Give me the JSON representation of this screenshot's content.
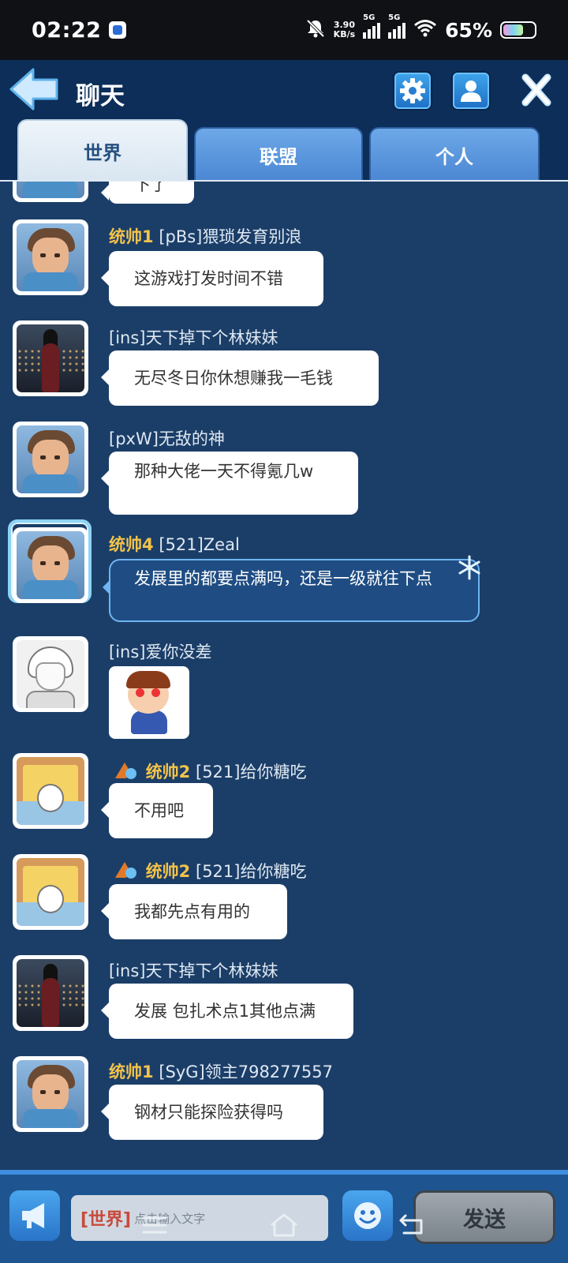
{
  "status_bar": {
    "time": "02:22",
    "net_speed_value": "3.90",
    "net_speed_unit": "KB/s",
    "signal1_label": "5G",
    "signal2_label": "5G",
    "battery": "65%"
  },
  "header": {
    "title": "聊天",
    "tabs": [
      "世界",
      "联盟",
      "个人"
    ],
    "active_tab": "世界"
  },
  "messages": [
    {
      "rank": "",
      "name": "",
      "text": "下了",
      "avatar": "hero"
    },
    {
      "rank": "统帅1",
      "name": "[pBs]猥琐发育别浪",
      "text": "这游戏打发时间不错",
      "avatar": "hero"
    },
    {
      "rank": "",
      "name": "[ins]天下掉下个林妹妹",
      "text": "无尽冬日你休想赚我一毛钱",
      "avatar": "girl"
    },
    {
      "rank": "",
      "name": "[pxW]无敌的神",
      "text": "那种大佬一天不得氪几w",
      "avatar": "hero"
    },
    {
      "rank": "统帅4",
      "name": "[521]Zeal",
      "text": "发展里的都要点满吗，还是一级就往下点",
      "avatar": "hero-ice"
    },
    {
      "rank": "",
      "name": "[ins]爱你没差",
      "text": "",
      "avatar": "anime",
      "sticker": "heart-eyes-boy"
    },
    {
      "rank": "统帅2",
      "name": "[521]给你糖吃",
      "text": "不用吧",
      "avatar": "shin"
    },
    {
      "rank": "统帅2",
      "name": "[521]给你糖吃",
      "text": "我都先点有用的",
      "avatar": "shin"
    },
    {
      "rank": "",
      "name": "[ins]天下掉下个林妹妹",
      "text": "发展 包扎术点1其他点满",
      "avatar": "girl"
    },
    {
      "rank": "统帅1",
      "name": "[SyG]领主798277557",
      "text": "钢材只能探险获得吗",
      "avatar": "hero"
    }
  ],
  "input_bar": {
    "channel": "[世界]",
    "placeholder": "点击输入文字",
    "send_label": "发送"
  },
  "icons": {
    "back": "back-arrow-icon",
    "settings": "gear-icon",
    "profile": "person-icon",
    "close": "close-icon",
    "horn": "megaphone-icon",
    "emoji": "smiley-icon"
  },
  "colors": {
    "background": "#1b3e68",
    "header": "#0d2e59",
    "rank_gold": "#f2c24a",
    "accent_blue": "#3ea5ec"
  }
}
